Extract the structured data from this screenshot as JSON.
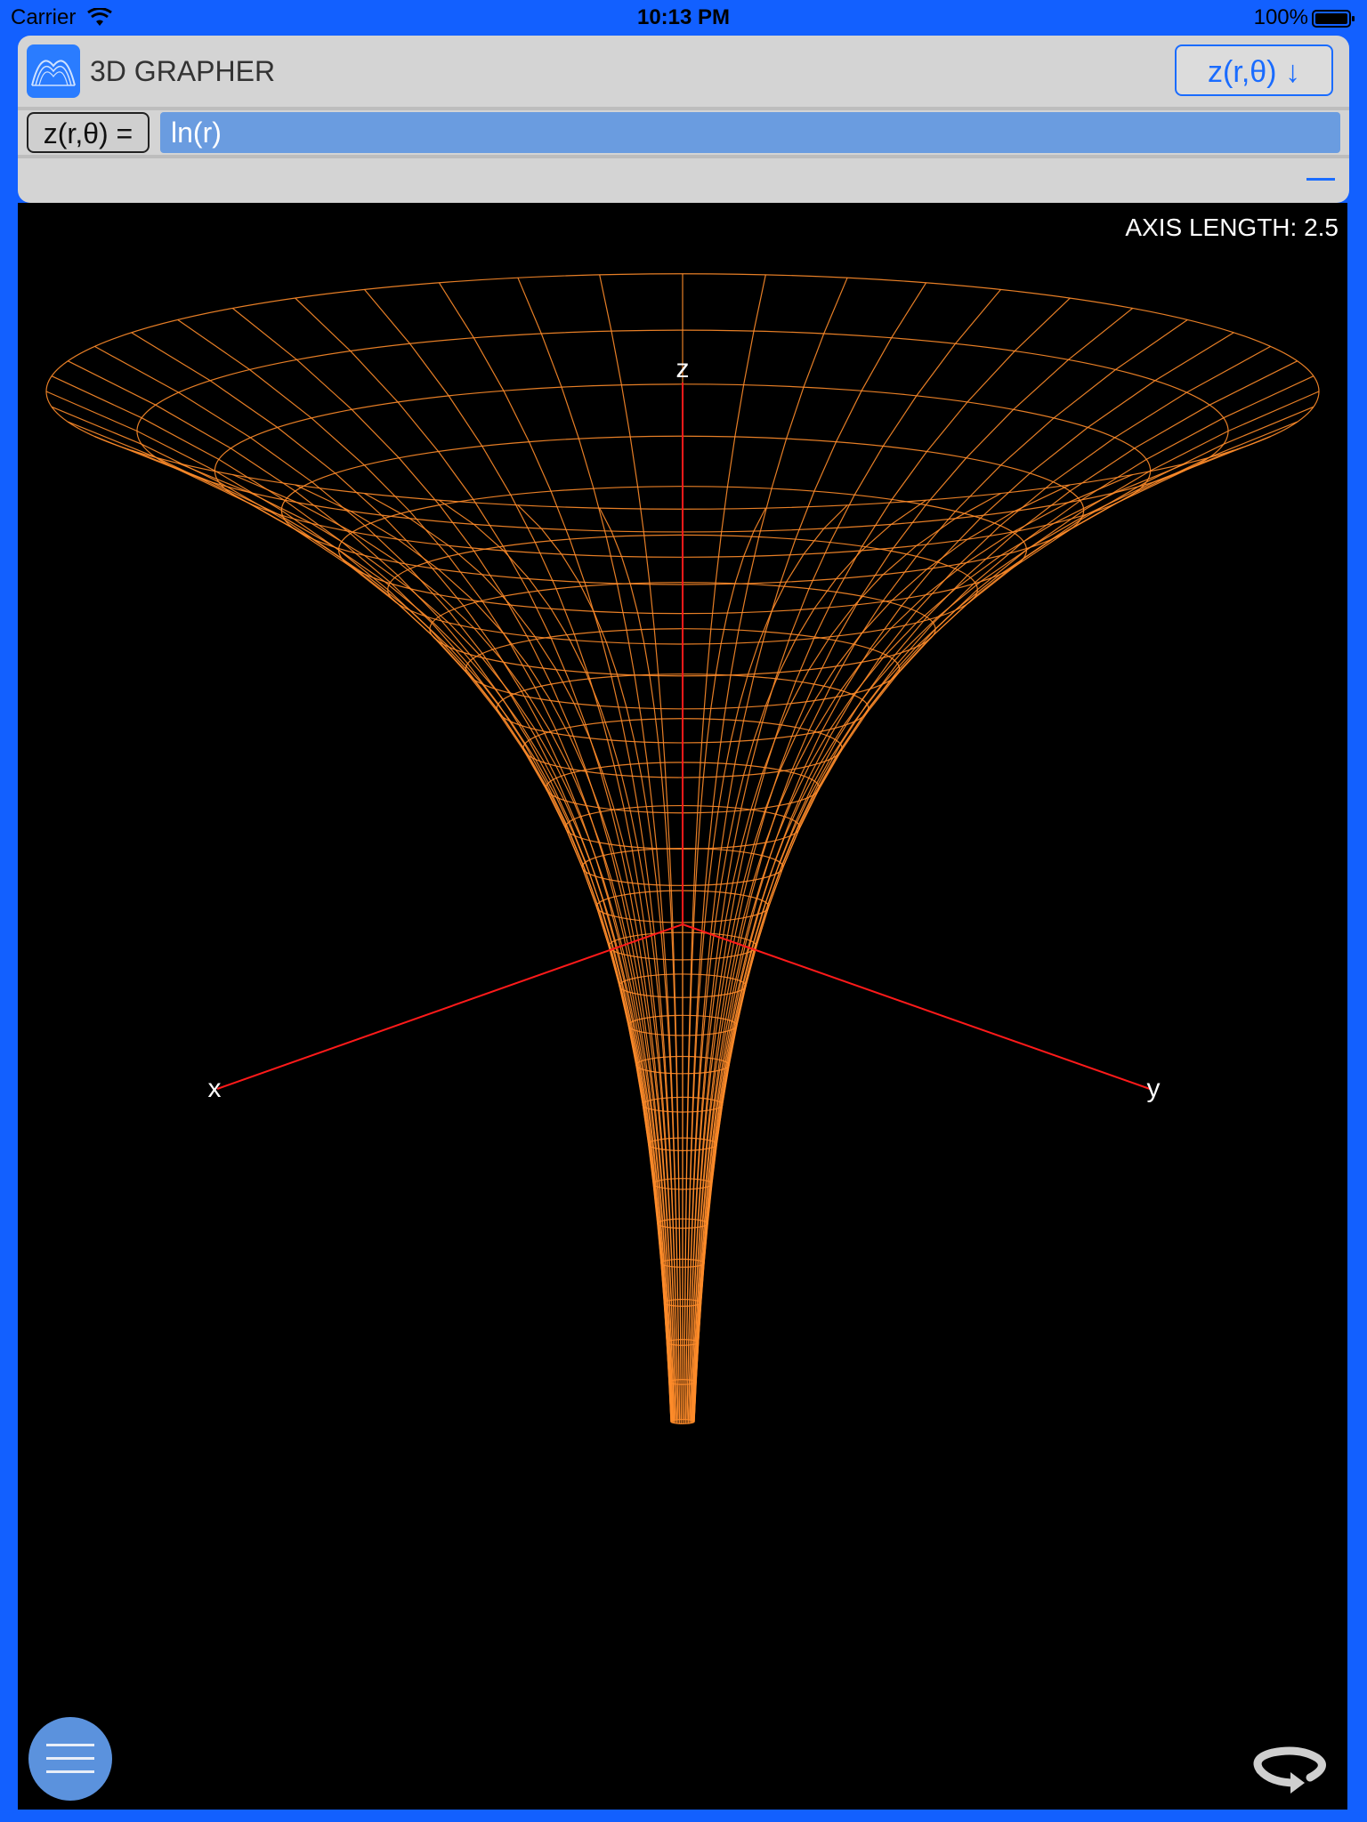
{
  "status": {
    "carrier": "Carrier",
    "time": "10:13 PM",
    "battery": "100%"
  },
  "header": {
    "title": "3D GRAPHER",
    "mode_button": "z(r,θ) ↓"
  },
  "function": {
    "label": "z(r,θ) =",
    "expression": "ln(r)"
  },
  "graph": {
    "axis_length_text": "AXIS LENGTH: 2.5",
    "axis_labels": {
      "x": "x",
      "y": "y",
      "z": "z"
    },
    "axis_length": 2.5,
    "surface": "z = ln(r)",
    "surface_color": "#ff8c2a",
    "axis_color": "#ff1a1a"
  },
  "colors": {
    "frame": "#1260ff",
    "accent": "#1a6cff",
    "input_bg": "#6a9ce0"
  },
  "icons": {
    "menu": "hamburger-icon",
    "rotate": "rotate-icon",
    "logo": "surface-logo-icon"
  }
}
